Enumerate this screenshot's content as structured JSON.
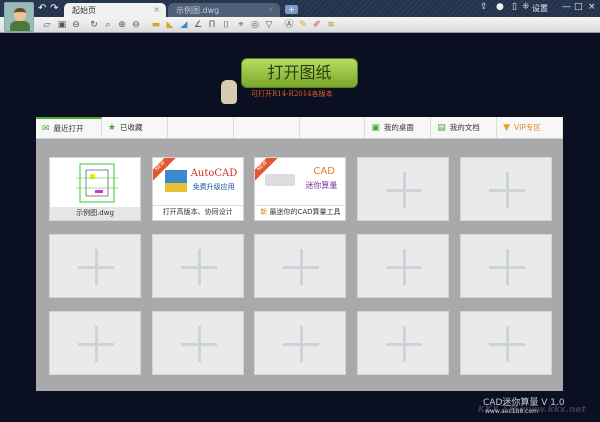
{
  "titlebar": {
    "tabs": [
      {
        "label": "起始页"
      },
      {
        "label": "示例图.dwg"
      }
    ],
    "new_tab": "+",
    "settings": "设置",
    "min": "—",
    "max": "□",
    "close": "×"
  },
  "main": {
    "open_button": "打开图纸",
    "subtitle": "可打开R14-R2014各版本"
  },
  "panel": {
    "tabs": [
      {
        "label": "最近打开",
        "icon": "envelope-icon"
      },
      {
        "label": "已收藏",
        "icon": "star-icon"
      },
      {
        "label": ""
      },
      {
        "label": ""
      },
      {
        "label": ""
      },
      {
        "label": "我的桌面",
        "icon": "desktop-icon"
      },
      {
        "label": "我的文档",
        "icon": "document-icon"
      },
      {
        "label": "VIP专区",
        "icon": "vip-icon"
      }
    ],
    "cards": [
      {
        "caption": "示例图.dwg"
      },
      {
        "caption": "打开高版本、协同设计",
        "title": "AutoCAD",
        "subtitle": "免费升级应用",
        "badge": "NEW"
      },
      {
        "caption": "最迷你的CAD算量工具",
        "title": "CAD",
        "subtitle": "迷你算量",
        "badge": "NEW",
        "caption_prefix": "新"
      }
    ]
  },
  "footer": {
    "version": "CAD迷你算量 V 1.0",
    "url": "www.aec188.com",
    "watermark": "KKX下载 www.kkx.net"
  },
  "colors": {
    "accent_green": "#8cc63f",
    "vip": "#e8a020"
  }
}
